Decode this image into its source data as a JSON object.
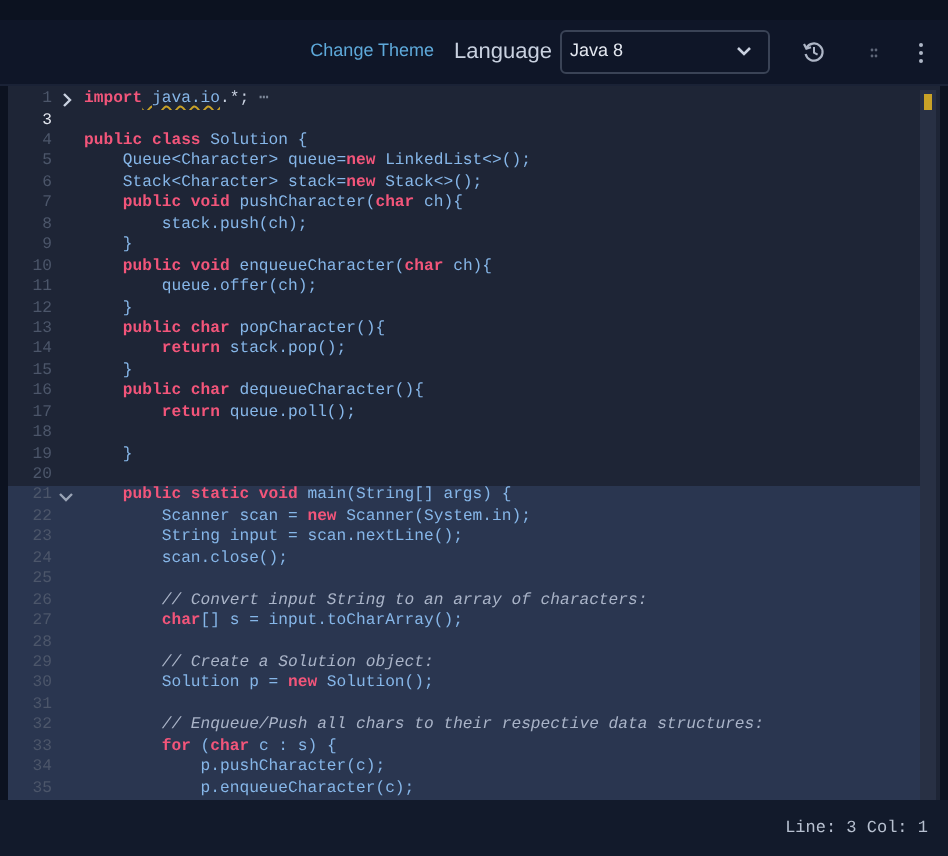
{
  "toolbar": {
    "theme_link": "Change Theme",
    "language_label": "Language",
    "language_value": "Java 8"
  },
  "editor": {
    "lines": [
      {
        "number": "1",
        "fold": {
          "expanded": false
        },
        "current": false,
        "highlighted": false,
        "tokens": [
          {
            "kind": "keyword",
            "text": "import"
          },
          {
            "kind": "warning",
            "text": " java.io"
          },
          {
            "kind": "plain",
            "text": ".*;"
          },
          {
            "kind": "fold",
            "text": " ⋯"
          }
        ]
      },
      {
        "number": "3",
        "current": true,
        "highlighted": false
      },
      {
        "number": "4",
        "current": false,
        "highlighted": false,
        "tokens": [
          {
            "kind": "keyword",
            "text": "public class"
          },
          {
            "kind": "ident",
            "text": " Solution {"
          }
        ]
      },
      {
        "number": "5",
        "current": false,
        "highlighted": false,
        "tokens": [
          {
            "kind": "ident",
            "text": "    Queue<Character> queue="
          },
          {
            "kind": "keyword",
            "text": "new"
          },
          {
            "kind": "ident",
            "text": " LinkedList<>();"
          }
        ]
      },
      {
        "number": "6",
        "current": false,
        "highlighted": false,
        "tokens": [
          {
            "kind": "ident",
            "text": "    Stack<Character> stack="
          },
          {
            "kind": "keyword",
            "text": "new"
          },
          {
            "kind": "ident",
            "text": " Stack<>();"
          }
        ]
      },
      {
        "number": "7",
        "current": false,
        "highlighted": false,
        "tokens": [
          {
            "kind": "keyword",
            "text": "    public void"
          },
          {
            "kind": "ident",
            "text": " pushCharacter("
          },
          {
            "kind": "keyword",
            "text": "char"
          },
          {
            "kind": "ident",
            "text": " ch){"
          }
        ]
      },
      {
        "number": "8",
        "current": false,
        "highlighted": false,
        "tokens": [
          {
            "kind": "ident",
            "text": "        stack.push(ch);"
          }
        ]
      },
      {
        "number": "9",
        "current": false,
        "highlighted": false,
        "tokens": [
          {
            "kind": "ident",
            "text": "    }"
          }
        ]
      },
      {
        "number": "10",
        "current": false,
        "highlighted": false,
        "tokens": [
          {
            "kind": "keyword",
            "text": "    public void"
          },
          {
            "kind": "ident",
            "text": " enqueueCharacter("
          },
          {
            "kind": "keyword",
            "text": "char"
          },
          {
            "kind": "ident",
            "text": " ch){"
          }
        ]
      },
      {
        "number": "11",
        "current": false,
        "highlighted": false,
        "tokens": [
          {
            "kind": "ident",
            "text": "        queue.offer(ch);"
          }
        ]
      },
      {
        "number": "12",
        "current": false,
        "highlighted": false,
        "tokens": [
          {
            "kind": "ident",
            "text": "    }"
          }
        ]
      },
      {
        "number": "13",
        "current": false,
        "highlighted": false,
        "tokens": [
          {
            "kind": "keyword",
            "text": "    public char"
          },
          {
            "kind": "ident",
            "text": " popCharacter(){"
          }
        ]
      },
      {
        "number": "14",
        "current": false,
        "highlighted": false,
        "tokens": [
          {
            "kind": "keyword",
            "text": "        return"
          },
          {
            "kind": "ident",
            "text": " stack.pop();"
          }
        ]
      },
      {
        "number": "15",
        "current": false,
        "highlighted": false,
        "tokens": [
          {
            "kind": "ident",
            "text": "    }"
          }
        ]
      },
      {
        "number": "16",
        "current": false,
        "highlighted": false,
        "tokens": [
          {
            "kind": "keyword",
            "text": "    public char"
          },
          {
            "kind": "ident",
            "text": " dequeueCharacter(){"
          }
        ]
      },
      {
        "number": "17",
        "current": false,
        "highlighted": false,
        "tokens": [
          {
            "kind": "keyword",
            "text": "        return"
          },
          {
            "kind": "ident",
            "text": " queue.poll();"
          }
        ]
      },
      {
        "number": "18",
        "current": false,
        "highlighted": false
      },
      {
        "number": "19",
        "current": false,
        "highlighted": false,
        "tokens": [
          {
            "kind": "ident",
            "text": "    }"
          }
        ]
      },
      {
        "number": "20",
        "current": false,
        "highlighted": false
      },
      {
        "number": "21",
        "fold": {
          "expanded": true
        },
        "current": false,
        "highlighted": true,
        "tokens": [
          {
            "kind": "keyword",
            "text": "    public static void"
          },
          {
            "kind": "ident",
            "text": " main(String[] args) {"
          }
        ]
      },
      {
        "number": "22",
        "current": false,
        "highlighted": true,
        "tokens": [
          {
            "kind": "ident",
            "text": "        Scanner scan = "
          },
          {
            "kind": "keyword",
            "text": "new"
          },
          {
            "kind": "ident",
            "text": " Scanner(System.in);"
          }
        ]
      },
      {
        "number": "23",
        "current": false,
        "highlighted": true,
        "tokens": [
          {
            "kind": "ident",
            "text": "        String input = scan.nextLine();"
          }
        ]
      },
      {
        "number": "24",
        "current": false,
        "highlighted": true,
        "tokens": [
          {
            "kind": "ident",
            "text": "        scan.close();"
          }
        ]
      },
      {
        "number": "25",
        "current": false,
        "highlighted": true
      },
      {
        "number": "26",
        "current": false,
        "highlighted": true,
        "tokens": [
          {
            "kind": "comment",
            "text": "        // Convert input String to an array of characters:"
          }
        ]
      },
      {
        "number": "27",
        "current": false,
        "highlighted": true,
        "tokens": [
          {
            "kind": "keyword",
            "text": "        char"
          },
          {
            "kind": "ident",
            "text": "[] s = input.toCharArray();"
          }
        ]
      },
      {
        "number": "28",
        "current": false,
        "highlighted": true
      },
      {
        "number": "29",
        "current": false,
        "highlighted": true,
        "tokens": [
          {
            "kind": "comment",
            "text": "        // Create a Solution object:"
          }
        ]
      },
      {
        "number": "30",
        "current": false,
        "highlighted": true,
        "tokens": [
          {
            "kind": "ident",
            "text": "        Solution p = "
          },
          {
            "kind": "keyword",
            "text": "new"
          },
          {
            "kind": "ident",
            "text": " Solution();"
          }
        ]
      },
      {
        "number": "31",
        "current": false,
        "highlighted": true
      },
      {
        "number": "32",
        "current": false,
        "highlighted": true,
        "tokens": [
          {
            "kind": "comment",
            "text": "        // Enqueue/Push all chars to their respective data structures:"
          }
        ]
      },
      {
        "number": "33",
        "current": false,
        "highlighted": true,
        "tokens": [
          {
            "kind": "keyword",
            "text": "        for"
          },
          {
            "kind": "ident",
            "text": " ("
          },
          {
            "kind": "keyword",
            "text": "char"
          },
          {
            "kind": "ident",
            "text": " c : s) {"
          }
        ]
      },
      {
        "number": "34",
        "current": false,
        "highlighted": true,
        "tokens": [
          {
            "kind": "ident",
            "text": "            p.pushCharacter(c);"
          }
        ]
      },
      {
        "number": "35",
        "current": false,
        "highlighted": true,
        "tokens": [
          {
            "kind": "ident",
            "text": "            p.enqueueCharacter(c);"
          }
        ]
      }
    ]
  },
  "status_bar": {
    "position": "Line: 3 Col: 1"
  }
}
